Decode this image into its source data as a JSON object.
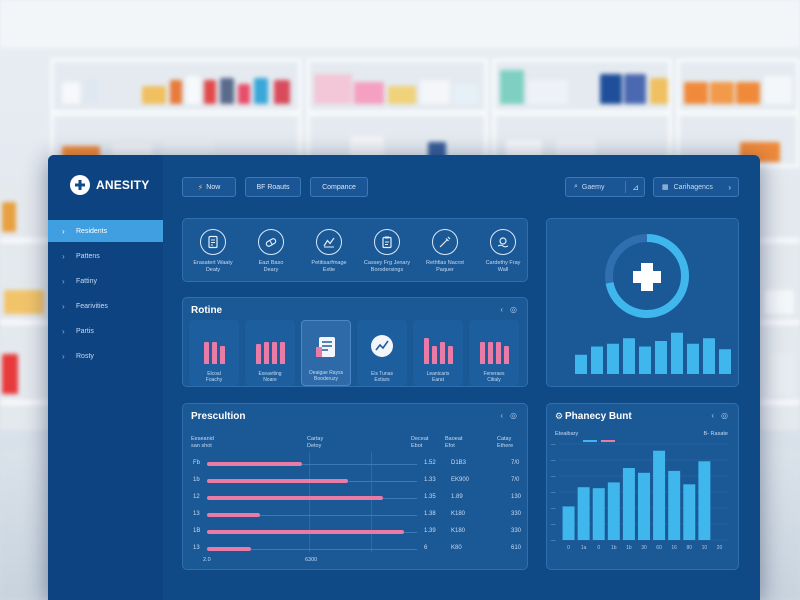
{
  "app": {
    "name": "ANESITY"
  },
  "sidebar": {
    "items": [
      {
        "label": "Residents",
        "active": true
      },
      {
        "label": "Pattens",
        "active": false
      },
      {
        "label": "Fattiny",
        "active": false
      },
      {
        "label": "Fearivities",
        "active": false
      },
      {
        "label": "Partis",
        "active": false
      },
      {
        "label": "Rosty",
        "active": false
      }
    ]
  },
  "topbar": {
    "btn_now": "Now",
    "btn_reports": "BF Roauts",
    "btn_compare": "Compance",
    "search_label": "Gaemy",
    "categories_label": "Carihagencs"
  },
  "quick_actions": [
    {
      "icon": "prescription-icon",
      "label": "Erasatert Waaty\nDeaty"
    },
    {
      "icon": "pill-icon",
      "label": "Eazi Baso\nDeary"
    },
    {
      "icon": "chart-icon",
      "label": "Petitisarfmage\nExtie"
    },
    {
      "icon": "clipboard-icon",
      "label": "Cassey Frg Jenary\nBorodersings"
    },
    {
      "icon": "vaccine-icon",
      "label": "Rethfias Nacrot\nPaquer"
    },
    {
      "icon": "pill-hand-icon",
      "label": "Cardethy Fray\nWall"
    }
  ],
  "routine": {
    "title": "Rotine",
    "tiles": [
      {
        "label": "Elcoal\nFoachy",
        "bars": [
          0.85,
          0.85,
          0.7
        ]
      },
      {
        "label": "Exeaviting\nNoare",
        "bars": [
          0.75,
          0.85,
          0.85,
          0.85
        ]
      },
      {
        "label": "Oeaigae Rayss\nBooderuzy",
        "highlight": true,
        "icon": "document-icon"
      },
      {
        "label": "Eis Tunas\nExtiurs",
        "icon": "chart-pie-icon"
      },
      {
        "label": "Leanicaris\nEarat",
        "bars": [
          1.0,
          0.7,
          0.85,
          0.7
        ]
      },
      {
        "label": "Feneraes\nCitialy",
        "bars": [
          0.85,
          0.85,
          0.85,
          0.7
        ]
      }
    ]
  },
  "prescription": {
    "title": "Prescultion",
    "headers": [
      "Eeseanid\nsan shot",
      "Cartay\nDetoy",
      "Deceat\nEbot",
      "Baoeat\nEfot",
      "Catay\nEthere"
    ],
    "rows": [
      {
        "id": "Fb",
        "fill": 0.45,
        "c1": "1.52",
        "c2": "D1B3",
        "c3": "7/0"
      },
      {
        "id": "1b",
        "fill": 0.67,
        "c1": "1.33",
        "c2": "EK900",
        "c3": "7/0"
      },
      {
        "id": "12",
        "fill": 0.84,
        "c1": "1.35",
        "c2": "1.89",
        "c3": "130"
      },
      {
        "id": "13",
        "fill": 0.25,
        "c1": "1.38",
        "c2": "K180",
        "c3": "330"
      },
      {
        "id": "1B",
        "fill": 0.94,
        "c1": "1.39",
        "c2": "K180",
        "c3": "330"
      },
      {
        "id": "13",
        "fill": 0.21,
        "c1": "6",
        "c2": "K80",
        "c3": "610"
      }
    ],
    "footer": [
      "2.0",
      "6300"
    ]
  },
  "summary": {
    "badge_icon": "plus-cross-icon",
    "ring_fill": 0.72,
    "bars": [
      0.35,
      0.5,
      0.55,
      0.65,
      0.5,
      0.6,
      0.75,
      0.55,
      0.65,
      0.45
    ]
  },
  "pharmacy_chart": {
    "title": "Phanecy Bunt",
    "legend_left": "Eteaibary",
    "legend_right": "B- Rasate",
    "x_labels": [
      "0",
      "1a",
      "0",
      "1b",
      "1b",
      "30",
      "60",
      "16",
      "80",
      "10",
      "20"
    ]
  },
  "chart_data": {
    "type": "bar",
    "title": "Phanecy Bunt",
    "categories": [
      "0",
      "1a",
      "0",
      "1b",
      "1b",
      "30",
      "60",
      "16",
      "80",
      "10",
      "20"
    ],
    "values": [
      0.35,
      0.55,
      0.54,
      0.6,
      0.75,
      0.7,
      0.93,
      0.72,
      0.58,
      0.82,
      0.0
    ],
    "ylim": [
      0,
      1
    ],
    "grid": true
  },
  "colors": {
    "panel": "#0f4a87",
    "accent": "#3f9fe0",
    "pink": "#ea7aa6",
    "bar_blue": "#3fb6ec"
  }
}
